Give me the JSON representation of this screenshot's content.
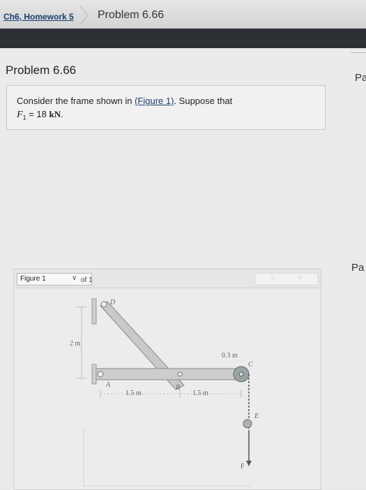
{
  "breadcrumb": {
    "first": "Ch6, Homework 5",
    "second": "Problem 6.66"
  },
  "page": {
    "title": "Problem 6.66",
    "side_label_top": "Pa",
    "side_label_bottom": "Pa"
  },
  "problem": {
    "text_before_link": "Consider the frame shown in ",
    "link_text": "(Figure 1)",
    "text_after_link": ". Suppose that",
    "given_var": "F",
    "given_sub": "1",
    "given_eq": " = 18 ",
    "given_unit": "kN",
    "given_end": "."
  },
  "figure": {
    "select_value": "Figure 1",
    "of_text": "of 1",
    "nav_prev": "<",
    "nav_next": ">",
    "labels": {
      "D": "D",
      "A": "A",
      "B": "B",
      "C": "C",
      "E": "E",
      "F": "F",
      "dim_height": "2 m",
      "dim_ab": "1.5 m",
      "dim_bc": "1.5 m",
      "dim_radius": "0.3 m"
    }
  }
}
